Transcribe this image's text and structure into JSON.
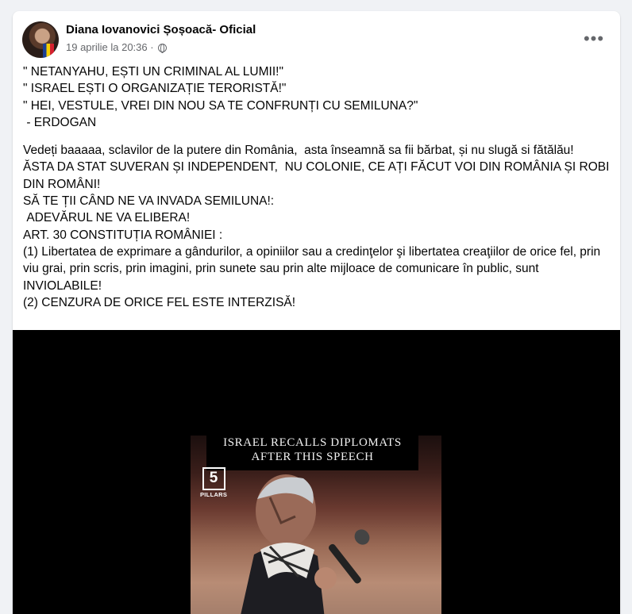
{
  "post": {
    "author": "Diana Iovanovici Șoșoacă- Oficial",
    "date": "19 aprilie la 20:36 ·",
    "paragraphs": [
      "\" NETANYAHU, EȘTI UN CRIMINAL AL LUMII!\"\n\" ISRAEL EȘTI O ORGANIZAȚIE TERORISTĂ!\"\n\" HEI, VESTULE, VREI DIN NOU SA TE CONFRUNȚI CU SEMILUNA?\"\n - ERDOGAN",
      "Vedeți baaaaa, sclavilor de la putere din România,  asta înseamnă sa fii bărbat, și nu slugă si fătălău!\nĂSTA DA STAT SUVERAN ȘI INDEPENDENT,  NU COLONIE, CE AȚI FĂCUT VOI DIN ROMÂNIA ȘI ROBI DIN ROMÂNI!\nSĂ TE ȚII CÂND NE VA INVADA SEMILUNA!:\n ADEVĂRUL NE VA ELIBERA!\nART. 30 CONSTITUȚIA ROMÂNIEI :\n(1) Libertatea de exprimare a gândurilor, a opiniilor sau a credinţelor şi libertatea creaţiilor de orice fel, prin viu grai, prin scris, prin imagini, prin sunete sau prin alte mijloace de comunicare în public, sunt INVIOLABILE!\n(2) CENZURA DE ORICE FEL ESTE INTERZISĂ!"
    ],
    "more_icon": "•••"
  },
  "video": {
    "caption_line1": "ISRAEL RECALLS DIPLOMATS",
    "caption_line2": "AFTER THIS SPEECH",
    "logo_number": "5",
    "logo_label": "PILLARS"
  }
}
